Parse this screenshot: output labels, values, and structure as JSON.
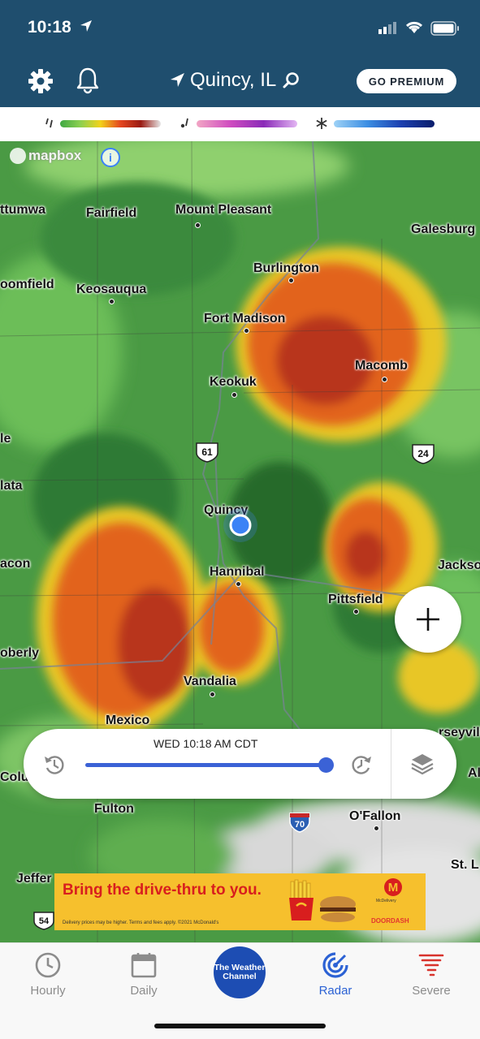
{
  "status_bar": {
    "time": "10:18"
  },
  "header": {
    "location": "Quincy, IL",
    "premium_label": "GO PREMIUM"
  },
  "legend": [
    {
      "type": "rain",
      "icon": "raindrop-icon",
      "colors": [
        "#3fa843",
        "#f2d21a",
        "#e4451e",
        "#9a1a12",
        "#e6e6e6"
      ]
    },
    {
      "type": "mix",
      "icon": "sleet-icon",
      "colors": [
        "#f2a6c4",
        "#d04cc0",
        "#8a2ab8",
        "#e3b6f3"
      ]
    },
    {
      "type": "snow",
      "icon": "snowflake-icon",
      "colors": [
        "#9ed2f6",
        "#3b8ee3",
        "#1b3fb0",
        "#0a1d6b"
      ]
    }
  ],
  "map": {
    "attribution": "mapbox",
    "cities": [
      "ttumwa",
      "Fairfield",
      "Mount Pleasant",
      "Galesburg",
      "Burlington",
      "oomfield",
      "Keosauqua",
      "Fort Madison",
      "Macomb",
      "Keokuk",
      "le",
      "lata",
      "Quincy",
      "acon",
      "Hannibal",
      "Jackso",
      "Pittsfield",
      "oberly",
      "Vandalia",
      "Mexico",
      "rseyvill",
      "Colu",
      "Al",
      "Fulton",
      "O'Fallon",
      "St. L",
      "Jeffer"
    ],
    "route_shields": [
      "61",
      "24",
      "70",
      "54"
    ],
    "zoom_label": "+"
  },
  "timeline": {
    "timestamp": "WED 10:18 AM CDT",
    "progress": 1.0
  },
  "ad": {
    "headline": "Bring the drive-thru to you.",
    "fine_print": "Delivery prices may be higher. Terms and fees apply. ©2021 McDonald's",
    "brand": "M",
    "delivery": "McDelivery",
    "partner": "DOORDASH"
  },
  "tabs": [
    {
      "label": "Hourly",
      "icon": "clock-icon",
      "active": false
    },
    {
      "label": "Daily",
      "icon": "calendar-icon",
      "active": false
    },
    {
      "label": "The Weather Channel",
      "icon": "twc-logo",
      "active": false
    },
    {
      "label": "Radar",
      "icon": "radar-icon",
      "active": true
    },
    {
      "label": "Severe",
      "icon": "tornado-icon",
      "active": false
    }
  ],
  "colors": {
    "header_bg": "#1f4e6e",
    "accent": "#2c62d4",
    "ad_bg": "#f6c02d"
  }
}
